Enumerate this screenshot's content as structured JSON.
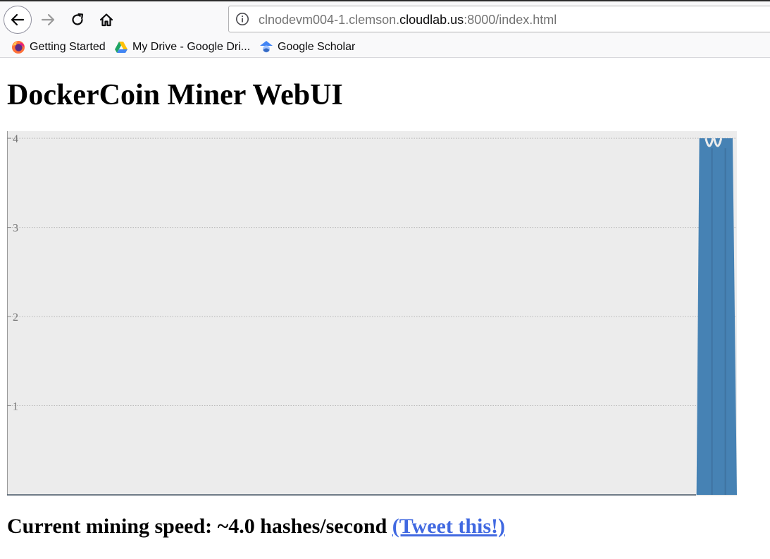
{
  "browser": {
    "url": {
      "prefix": "clnodevm004-1.clemson.",
      "domain": "cloudlab.us",
      "suffix": ":8000/index.html"
    },
    "bookmarks": [
      {
        "label": "Getting Started",
        "icon": "firefox-icon"
      },
      {
        "label": "My Drive - Google Dri...",
        "icon": "google-drive-icon"
      },
      {
        "label": "Google Scholar",
        "icon": "google-scholar-icon"
      }
    ]
  },
  "page": {
    "title": "DockerCoin Miner WebUI",
    "speed_text": "Current mining speed: ~4.0 hashes/second ",
    "tweet_label": "(Tweet this!)"
  },
  "chart_data": {
    "type": "area",
    "ylim": [
      0,
      4.08
    ],
    "yticks": [
      1,
      2,
      3,
      4
    ],
    "grid": true,
    "background": "#ececec",
    "fill": "#4682b4",
    "x": [
      0,
      1,
      2,
      3,
      4,
      5,
      6,
      7,
      8,
      9,
      10,
      11,
      12,
      13,
      14,
      15,
      16,
      17,
      18
    ],
    "values": [
      0,
      0,
      0,
      0,
      0,
      0,
      0,
      0,
      0,
      0,
      0,
      0,
      0,
      0,
      0,
      0,
      4,
      4,
      4
    ],
    "xlabel": "",
    "ylabel": "",
    "title": ""
  }
}
